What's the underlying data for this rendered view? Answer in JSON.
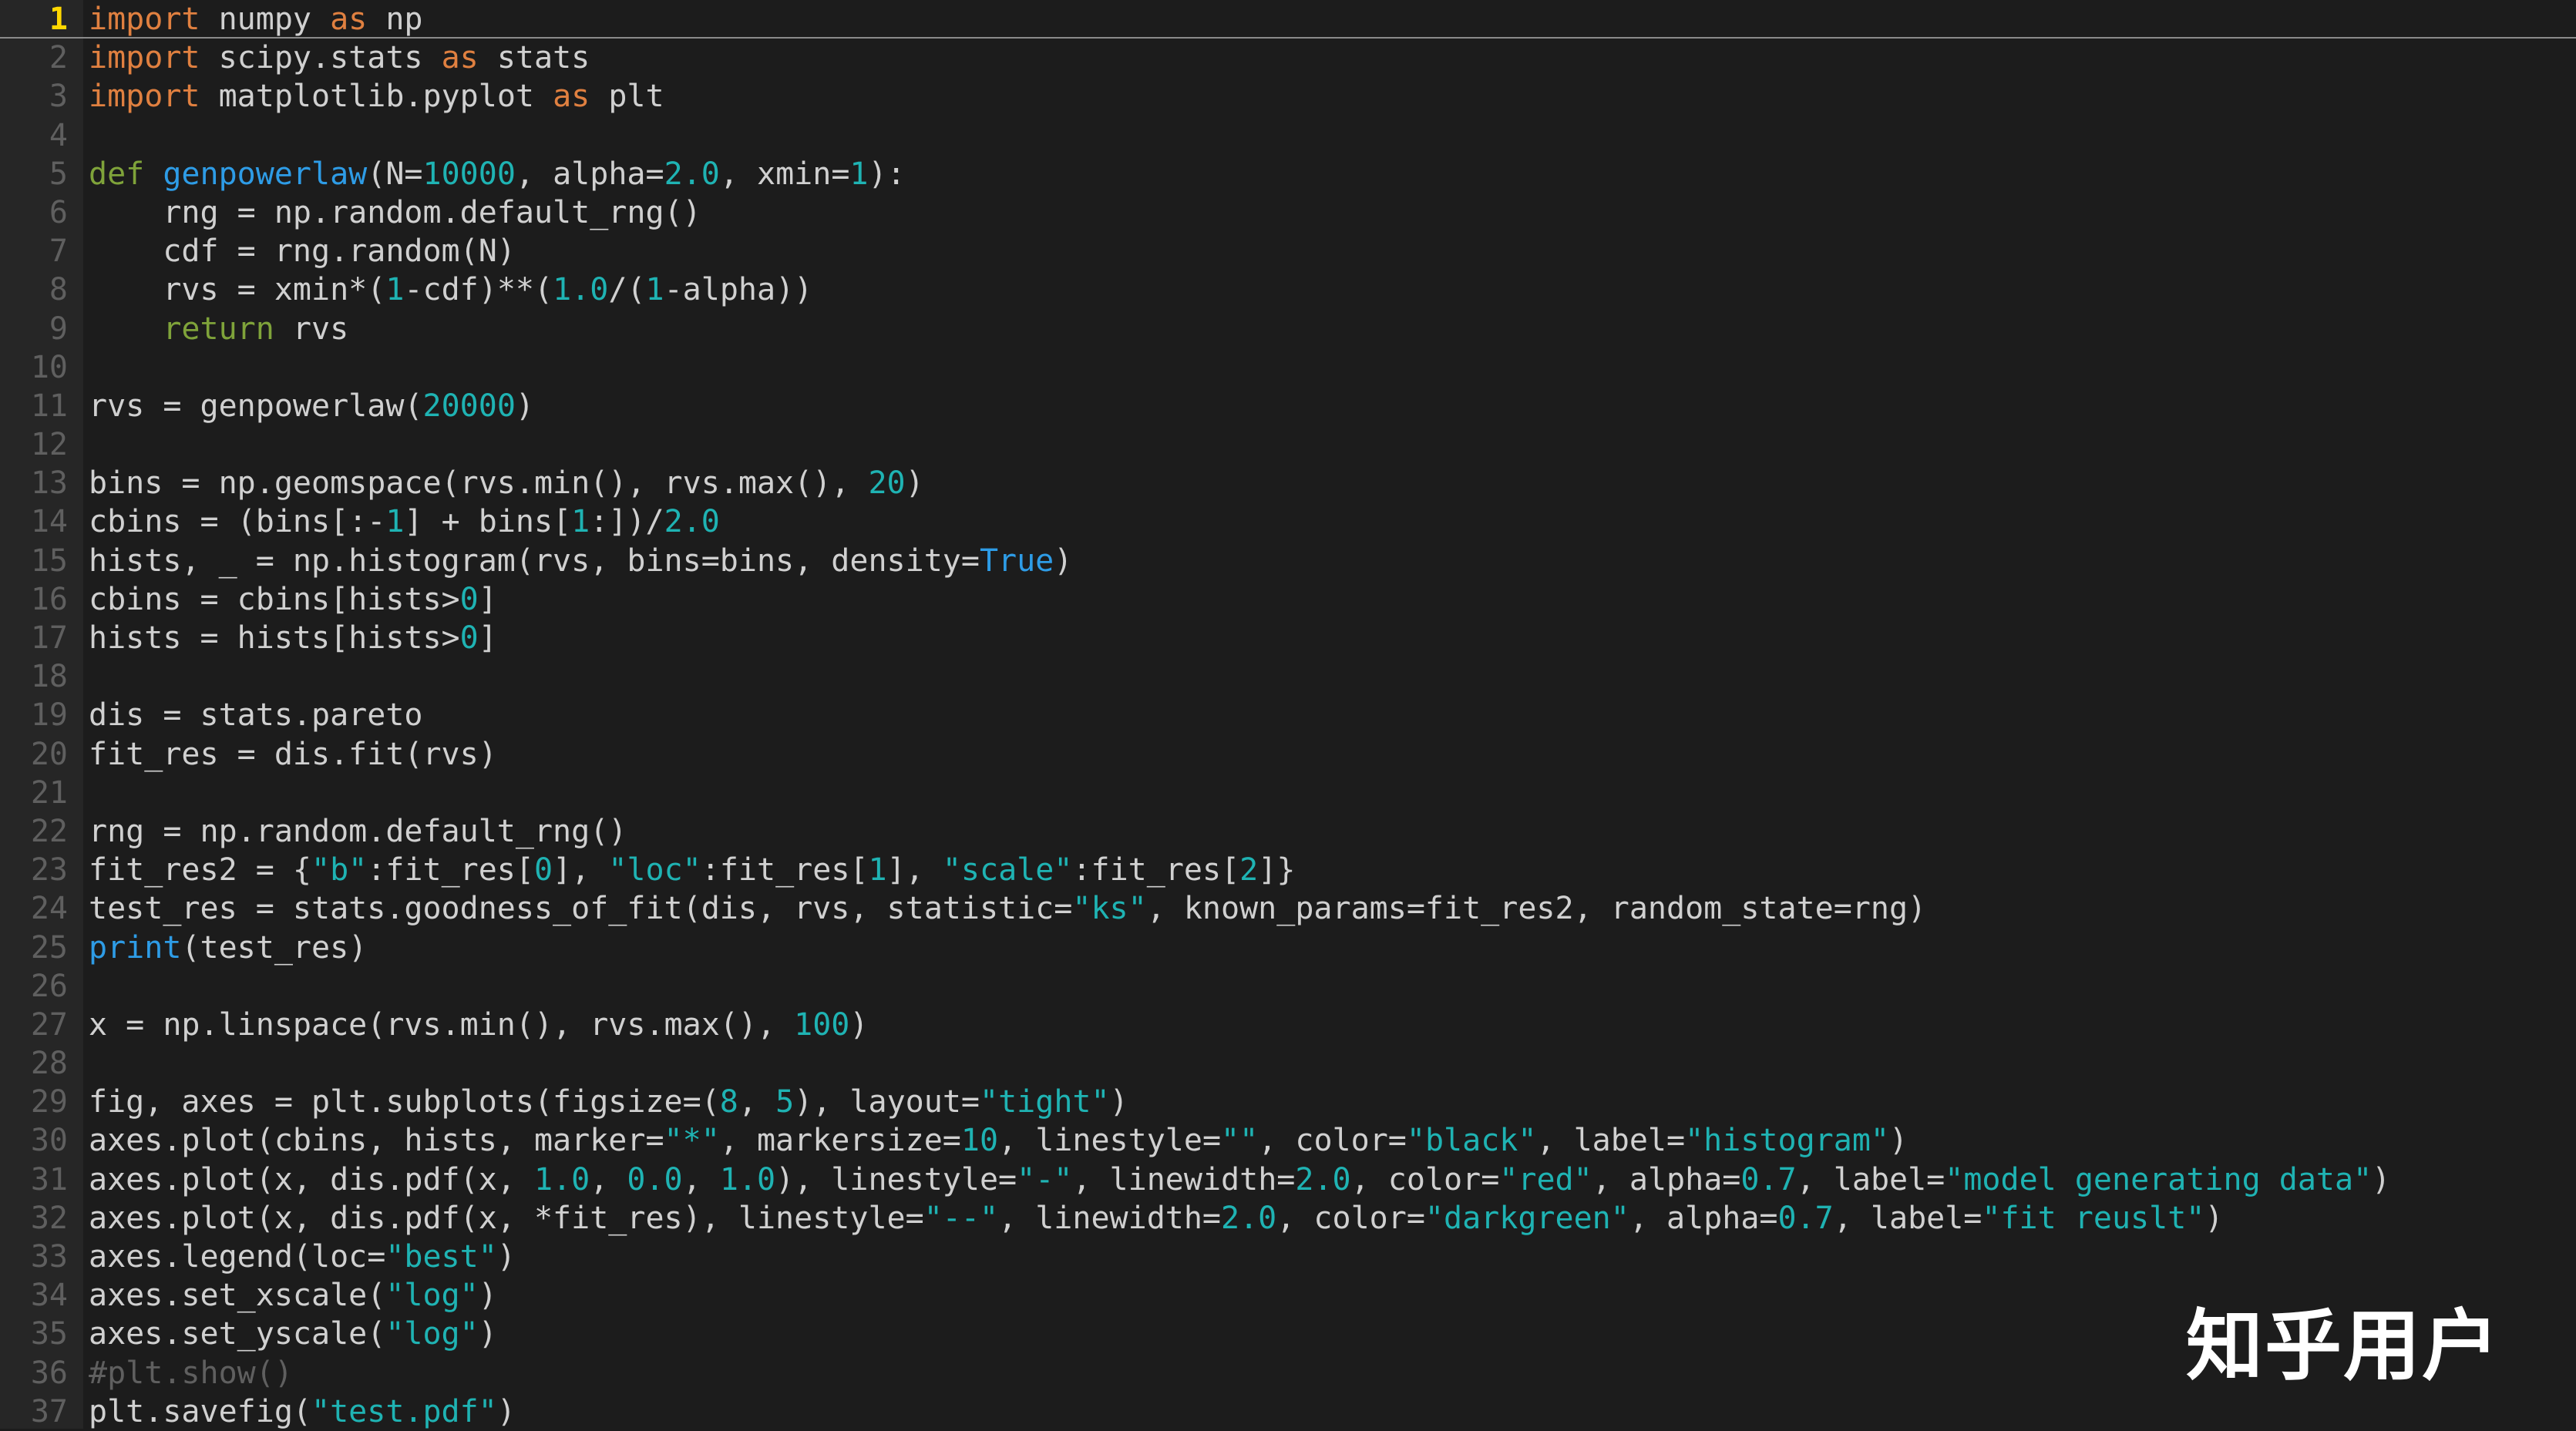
{
  "editor": {
    "current_line": 1,
    "lines": [
      {
        "n": "1",
        "tokens": [
          [
            "kw",
            "import"
          ],
          [
            "t",
            " numpy "
          ],
          [
            "kw",
            "as"
          ],
          [
            "t",
            " np"
          ]
        ]
      },
      {
        "n": "2",
        "tokens": [
          [
            "kw",
            "import"
          ],
          [
            "t",
            " scipy.stats "
          ],
          [
            "kw",
            "as"
          ],
          [
            "t",
            " stats"
          ]
        ]
      },
      {
        "n": "3",
        "tokens": [
          [
            "kw",
            "import"
          ],
          [
            "t",
            " matplotlib.pyplot "
          ],
          [
            "kw",
            "as"
          ],
          [
            "t",
            " plt"
          ]
        ]
      },
      {
        "n": "4",
        "tokens": []
      },
      {
        "n": "5",
        "tokens": [
          [
            "kw2",
            "def"
          ],
          [
            "t",
            " "
          ],
          [
            "fn",
            "genpowerlaw"
          ],
          [
            "t",
            "(N="
          ],
          [
            "num",
            "10000"
          ],
          [
            "t",
            ", alpha="
          ],
          [
            "num",
            "2.0"
          ],
          [
            "t",
            ", xmin="
          ],
          [
            "num",
            "1"
          ],
          [
            "t",
            "):"
          ]
        ]
      },
      {
        "n": "6",
        "tokens": [
          [
            "t",
            "    rng = np.random.default_rng()"
          ]
        ]
      },
      {
        "n": "7",
        "tokens": [
          [
            "t",
            "    cdf = rng.random(N)"
          ]
        ]
      },
      {
        "n": "8",
        "tokens": [
          [
            "t",
            "    rvs = xmin*("
          ],
          [
            "num",
            "1"
          ],
          [
            "t",
            "-cdf)**("
          ],
          [
            "num",
            "1.0"
          ],
          [
            "t",
            "/("
          ],
          [
            "num",
            "1"
          ],
          [
            "t",
            "-alpha))"
          ]
        ]
      },
      {
        "n": "9",
        "tokens": [
          [
            "t",
            "    "
          ],
          [
            "kw2",
            "return"
          ],
          [
            "t",
            " rvs"
          ]
        ]
      },
      {
        "n": "10",
        "tokens": []
      },
      {
        "n": "11",
        "tokens": [
          [
            "t",
            "rvs = genpowerlaw("
          ],
          [
            "num",
            "20000"
          ],
          [
            "t",
            ")"
          ]
        ]
      },
      {
        "n": "12",
        "tokens": []
      },
      {
        "n": "13",
        "tokens": [
          [
            "t",
            "bins = np.geomspace(rvs.min(), rvs.max(), "
          ],
          [
            "num",
            "20"
          ],
          [
            "t",
            ")"
          ]
        ]
      },
      {
        "n": "14",
        "tokens": [
          [
            "t",
            "cbins = (bins[:-"
          ],
          [
            "num",
            "1"
          ],
          [
            "t",
            "] + bins["
          ],
          [
            "num",
            "1"
          ],
          [
            "t",
            ":])/"
          ],
          [
            "num",
            "2.0"
          ]
        ]
      },
      {
        "n": "15",
        "tokens": [
          [
            "t",
            "hists, _ = np.histogram(rvs, bins=bins, density="
          ],
          [
            "fn",
            "True"
          ],
          [
            "t",
            ")"
          ]
        ]
      },
      {
        "n": "16",
        "tokens": [
          [
            "t",
            "cbins = cbins[hists>"
          ],
          [
            "num",
            "0"
          ],
          [
            "t",
            "]"
          ]
        ]
      },
      {
        "n": "17",
        "tokens": [
          [
            "t",
            "hists = hists[hists>"
          ],
          [
            "num",
            "0"
          ],
          [
            "t",
            "]"
          ]
        ]
      },
      {
        "n": "18",
        "tokens": []
      },
      {
        "n": "19",
        "tokens": [
          [
            "t",
            "dis = stats.pareto"
          ]
        ]
      },
      {
        "n": "20",
        "tokens": [
          [
            "t",
            "fit_res = dis.fit(rvs)"
          ]
        ]
      },
      {
        "n": "21",
        "tokens": []
      },
      {
        "n": "22",
        "tokens": [
          [
            "t",
            "rng = np.random.default_rng()"
          ]
        ]
      },
      {
        "n": "23",
        "tokens": [
          [
            "t",
            "fit_res2 = {"
          ],
          [
            "str",
            "\"b\""
          ],
          [
            "t",
            ":fit_res["
          ],
          [
            "num",
            "0"
          ],
          [
            "t",
            "], "
          ],
          [
            "str",
            "\"loc\""
          ],
          [
            "t",
            ":fit_res["
          ],
          [
            "num",
            "1"
          ],
          [
            "t",
            "], "
          ],
          [
            "str",
            "\"scale\""
          ],
          [
            "t",
            ":fit_res["
          ],
          [
            "num",
            "2"
          ],
          [
            "t",
            "]}"
          ]
        ]
      },
      {
        "n": "24",
        "tokens": [
          [
            "t",
            "test_res = stats.goodness_of_fit(dis, rvs, statistic="
          ],
          [
            "str",
            "\"ks\""
          ],
          [
            "t",
            ", known_params=fit_res2, random_state=rng)"
          ]
        ]
      },
      {
        "n": "25",
        "tokens": [
          [
            "fn",
            "print"
          ],
          [
            "t",
            "(test_res)"
          ]
        ]
      },
      {
        "n": "26",
        "tokens": []
      },
      {
        "n": "27",
        "tokens": [
          [
            "t",
            "x = np.linspace(rvs.min(), rvs.max(), "
          ],
          [
            "num",
            "100"
          ],
          [
            "t",
            ")"
          ]
        ]
      },
      {
        "n": "28",
        "tokens": []
      },
      {
        "n": "29",
        "tokens": [
          [
            "t",
            "fig, axes = plt.subplots(figsize=("
          ],
          [
            "num",
            "8"
          ],
          [
            "t",
            ", "
          ],
          [
            "num",
            "5"
          ],
          [
            "t",
            "), layout="
          ],
          [
            "str",
            "\"tight\""
          ],
          [
            "t",
            ")"
          ]
        ]
      },
      {
        "n": "30",
        "tokens": [
          [
            "t",
            "axes.plot(cbins, hists, marker="
          ],
          [
            "str",
            "\"*\""
          ],
          [
            "t",
            ", markersize="
          ],
          [
            "num",
            "10"
          ],
          [
            "t",
            ", linestyle="
          ],
          [
            "str",
            "\"\""
          ],
          [
            "t",
            ", color="
          ],
          [
            "str",
            "\"black\""
          ],
          [
            "t",
            ", label="
          ],
          [
            "str",
            "\"histogram\""
          ],
          [
            "t",
            ")"
          ]
        ]
      },
      {
        "n": "31",
        "tokens": [
          [
            "t",
            "axes.plot(x, dis.pdf(x, "
          ],
          [
            "num",
            "1.0"
          ],
          [
            "t",
            ", "
          ],
          [
            "num",
            "0.0"
          ],
          [
            "t",
            ", "
          ],
          [
            "num",
            "1.0"
          ],
          [
            "t",
            "), linestyle="
          ],
          [
            "str",
            "\"-\""
          ],
          [
            "t",
            ", linewidth="
          ],
          [
            "num",
            "2.0"
          ],
          [
            "t",
            ", color="
          ],
          [
            "str",
            "\"red\""
          ],
          [
            "t",
            ", alpha="
          ],
          [
            "num",
            "0.7"
          ],
          [
            "t",
            ", label="
          ],
          [
            "str",
            "\"model generating data\""
          ],
          [
            "t",
            ")"
          ]
        ]
      },
      {
        "n": "32",
        "tokens": [
          [
            "t",
            "axes.plot(x, dis.pdf(x, *fit_res), linestyle="
          ],
          [
            "str",
            "\"--\""
          ],
          [
            "t",
            ", linewidth="
          ],
          [
            "num",
            "2.0"
          ],
          [
            "t",
            ", color="
          ],
          [
            "str",
            "\"darkgreen\""
          ],
          [
            "t",
            ", alpha="
          ],
          [
            "num",
            "0.7"
          ],
          [
            "t",
            ", label="
          ],
          [
            "str",
            "\"fit reuslt\""
          ],
          [
            "t",
            ")"
          ]
        ]
      },
      {
        "n": "33",
        "tokens": [
          [
            "t",
            "axes.legend(loc="
          ],
          [
            "str",
            "\"best\""
          ],
          [
            "t",
            ")"
          ]
        ]
      },
      {
        "n": "34",
        "tokens": [
          [
            "t",
            "axes.set_xscale("
          ],
          [
            "str",
            "\"log\""
          ],
          [
            "t",
            ")"
          ]
        ]
      },
      {
        "n": "35",
        "tokens": [
          [
            "t",
            "axes.set_yscale("
          ],
          [
            "str",
            "\"log\""
          ],
          [
            "t",
            ")"
          ]
        ]
      },
      {
        "n": "36",
        "tokens": [
          [
            "cm",
            "#plt.show()"
          ]
        ]
      },
      {
        "n": "37",
        "tokens": [
          [
            "t",
            "plt.savefig("
          ],
          [
            "str",
            "\"test.pdf\""
          ],
          [
            "t",
            ")"
          ]
        ]
      }
    ]
  },
  "watermark": "知乎用户"
}
